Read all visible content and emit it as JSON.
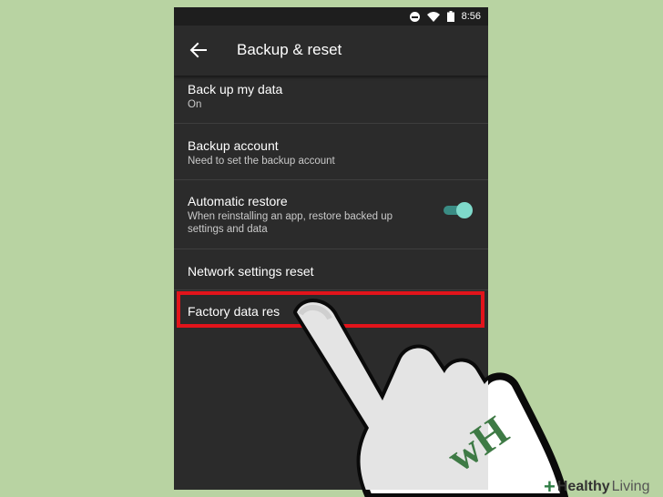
{
  "status_bar": {
    "time": "8:56",
    "icons": [
      "do-not-disturb-icon",
      "wifi-icon",
      "battery-icon"
    ]
  },
  "app_bar": {
    "back_icon": "arrow-left-icon",
    "title": "Backup & reset"
  },
  "settings": {
    "items": [
      {
        "title": "Back up my data",
        "subtitle": "On"
      },
      {
        "title": "Backup account",
        "subtitle": "Need to set the backup account"
      },
      {
        "title": "Automatic restore",
        "subtitle": "When reinstalling an app, restore backed up settings and data",
        "toggle_on": true
      },
      {
        "title": "Network settings reset"
      },
      {
        "title": "Factory data res"
      }
    ]
  },
  "overlay": {
    "highlight_color": "#e2141b",
    "hand_watermark": "wH"
  },
  "branding": {
    "plus": "+",
    "word1": "Healthy",
    "word2": "Living"
  },
  "colors": {
    "background": "#b8d3a2",
    "phone_surface": "#2b2b2b",
    "toggle_accent": "#7fdacb"
  }
}
